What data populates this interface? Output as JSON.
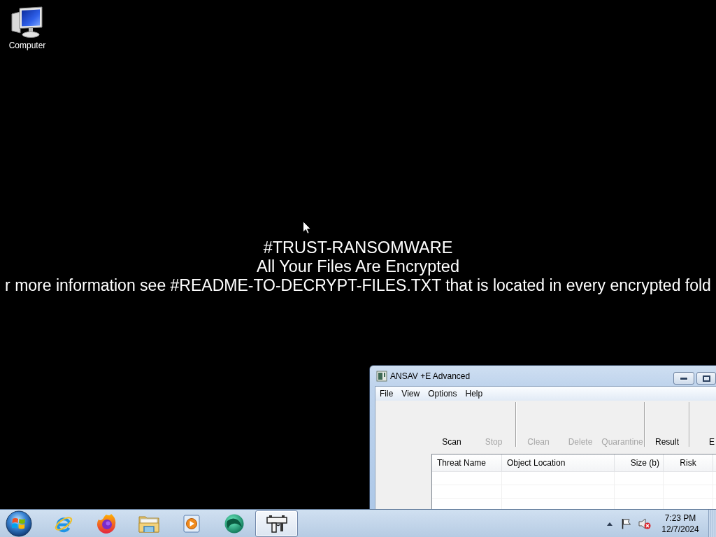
{
  "desktop": {
    "icons": [
      {
        "label": "Computer"
      }
    ]
  },
  "wallpaper_text": {
    "title": "#TRUST-RANSOMWARE",
    "subtitle": "All Your Files Are Encrypted",
    "message": "r more information see #README-TO-DECRYPT-FILES.TXT that is located in every encrypted fold"
  },
  "window": {
    "title": "ANSAV +E Advanced",
    "menu": [
      "File",
      "View",
      "Options",
      "Help"
    ],
    "toolbar": [
      {
        "kind": "button",
        "label": "Scan",
        "disabled": false
      },
      {
        "kind": "button",
        "label": "Stop",
        "disabled": true
      },
      {
        "kind": "separator"
      },
      {
        "kind": "button",
        "label": "Clean",
        "disabled": true
      },
      {
        "kind": "button",
        "label": "Delete",
        "disabled": true
      },
      {
        "kind": "button",
        "label": "Quarantine",
        "disabled": true
      },
      {
        "kind": "separator"
      },
      {
        "kind": "button",
        "label": "Result",
        "disabled": false
      },
      {
        "kind": "separator"
      },
      {
        "kind": "button",
        "label": "E",
        "disabled": false
      }
    ],
    "table": {
      "columns": [
        "Threat Name",
        "Object Location",
        "Size (b)",
        "Risk"
      ]
    }
  },
  "taskbar": {
    "apps": [
      {
        "selected": false
      },
      {
        "selected": false
      },
      {
        "selected": false
      },
      {
        "selected": false
      },
      {
        "selected": false
      },
      {
        "selected": true
      }
    ],
    "tray": {
      "volume_muted": true,
      "time": "7:23 PM",
      "date": "12/7/2024"
    }
  }
}
